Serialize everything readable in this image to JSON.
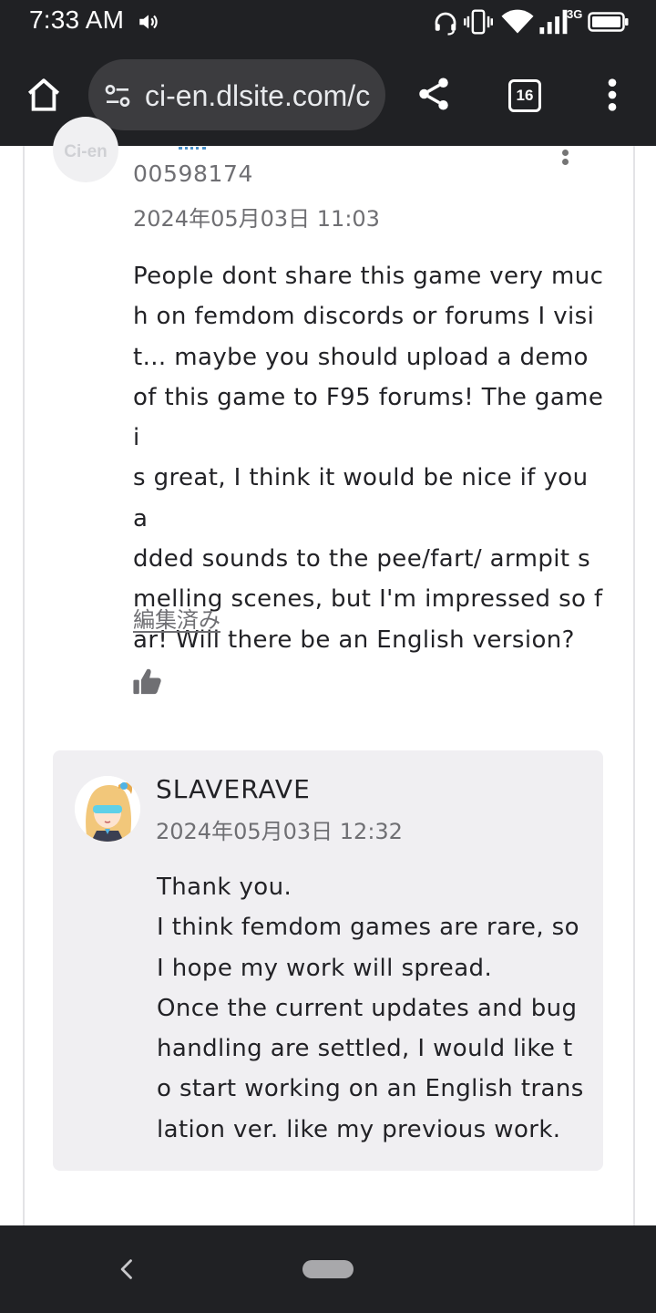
{
  "status_bar": {
    "time": "7:33 AM",
    "network": "3G",
    "icons": [
      "volume-icon",
      "headset-icon",
      "vibrate-icon",
      "wifi-icon",
      "signal-icon",
      "battery-icon"
    ]
  },
  "browser": {
    "url": "ci-en.dlsite.com/c",
    "tab_count": "16",
    "icons": [
      "home-icon",
      "site-settings-icon",
      "share-icon",
      "tabs-icon",
      "more-icon"
    ]
  },
  "comment": {
    "avatar_logo": "Ci-en",
    "user_id": "00598174",
    "date": "2024年05月03日 11:03",
    "body": "People dont share this game very muc\nh on femdom discords or forums I visi\nt... maybe you should upload a demo\nof this game to F95 forums! The game i\ns great, I think it would be nice if you a\ndded sounds to the pee/fart/ armpit s\nmelling scenes, but I'm impressed so f\nar! Will there be an English version?",
    "edited_label": "編集済み"
  },
  "reply": {
    "author": "SLAVERAVE",
    "date": "2024年05月03日 12:32",
    "body": "Thank you.\nI think femdom games are rare, so\nI hope my work will spread.\nOnce the current updates and bug\nhandling are settled, I would like t\no start working on an English trans\nlation ver. like my previous work."
  },
  "colors": {
    "chrome": "#202124",
    "url_bar": "#3c3c3f",
    "reply_bg": "#f0eff2",
    "muted_text": "#6f6f73",
    "body_text": "#222226"
  }
}
